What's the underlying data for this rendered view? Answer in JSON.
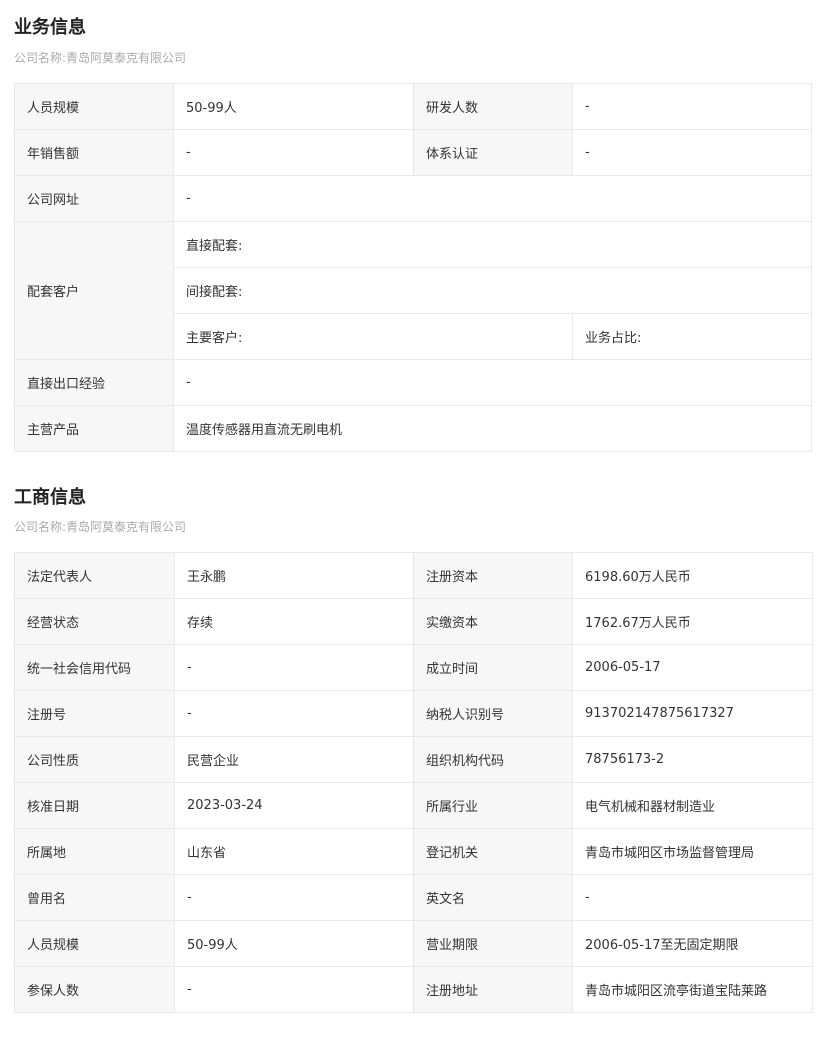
{
  "business": {
    "title": "业务信息",
    "company_label": "公司名称:",
    "company_name": "青岛阿莫泰克有限公司",
    "staff_size_label": "人员规模",
    "staff_size_value": "50-99人",
    "rd_staff_label": "研发人数",
    "rd_staff_value": "-",
    "annual_sales_label": "年销售额",
    "annual_sales_value": "-",
    "certification_label": "体系认证",
    "certification_value": "-",
    "website_label": "公司网址",
    "website_value": "-",
    "supporting_customers_label": "配套客户",
    "direct_supply_label": "直接配套:",
    "indirect_supply_label": "间接配套:",
    "main_customers_label": "主要客户:",
    "business_share_label": "业务占比:",
    "direct_export_label": "直接出口经验",
    "direct_export_value": "-",
    "main_products_label": "主营产品",
    "main_products_value": "温度传感器用直流无刷电机"
  },
  "industrial": {
    "title": "工商信息",
    "company_label": "公司名称:",
    "company_name": "青岛阿莫泰克有限公司",
    "rows": [
      {
        "l1": "法定代表人",
        "v1": "王永鹏",
        "l2": "注册资本",
        "v2": "6198.60万人民币"
      },
      {
        "l1": "经营状态",
        "v1": "存续",
        "l2": "实缴资本",
        "v2": "1762.67万人民币"
      },
      {
        "l1": "统一社会信用代码",
        "v1": "-",
        "l2": "成立时间",
        "v2": "2006-05-17"
      },
      {
        "l1": "注册号",
        "v1": "-",
        "l2": "纳税人识别号",
        "v2": "913702147875617327"
      },
      {
        "l1": "公司性质",
        "v1": "民营企业",
        "l2": "组织机构代码",
        "v2": "78756173-2"
      },
      {
        "l1": "核准日期",
        "v1": "2023-03-24",
        "l2": "所属行业",
        "v2": "电气机械和器材制造业"
      },
      {
        "l1": "所属地",
        "v1": "山东省",
        "l2": "登记机关",
        "v2": "青岛市城阳区市场监督管理局"
      },
      {
        "l1": "曾用名",
        "v1": "-",
        "l2": "英文名",
        "v2": "-"
      },
      {
        "l1": "人员规模",
        "v1": "50-99人",
        "l2": "营业期限",
        "v2": "2006-05-17至无固定期限"
      },
      {
        "l1": "参保人数",
        "v1": "-",
        "l2": "注册地址",
        "v2": "青岛市城阳区流亭街道宝陆莱路"
      }
    ]
  }
}
